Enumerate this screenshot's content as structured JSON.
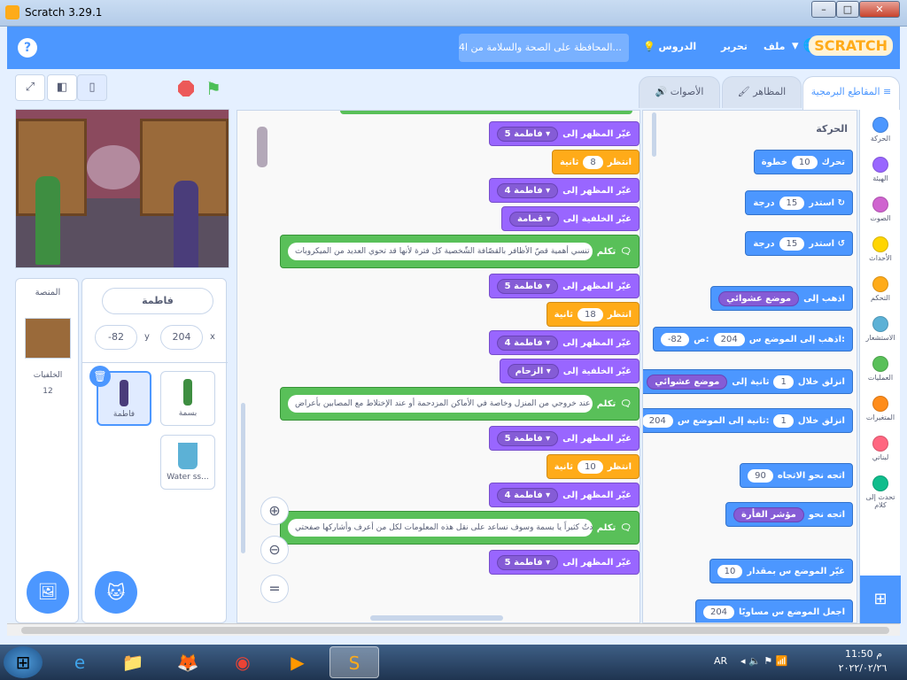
{
  "window": {
    "title": "Scratch 3.29.1",
    "minimize": "–",
    "maximize": "□",
    "close": "✕"
  },
  "menubar": {
    "logo": "SCRATCH",
    "file": "ملف",
    "edit": "تحرير",
    "tutorials": "الدروس",
    "project_title": "4المحافظة على الصحة والسلامة من ا...",
    "help": "?"
  },
  "tabs": {
    "code": "المقاطع البرمجية",
    "costumes": "المظاهر",
    "sounds": "الأصوات"
  },
  "sprite_info": {
    "name": "فاطمة",
    "x_label": "x",
    "x_value": "204",
    "y_label": "y",
    "y_value": "-82",
    "sprites": [
      {
        "name": "فاطمة"
      },
      {
        "name": "بسمة"
      },
      {
        "name": "Water ss..."
      }
    ]
  },
  "stage_panel": {
    "title": "المنصة",
    "backdrops_label": "الخلفيات",
    "backdrops_count": "12"
  },
  "script": [
    {
      "type": "looks",
      "text": "غيّر المظهر إلى",
      "value": "فاطمة 5"
    },
    {
      "type": "ctrl",
      "text": "انتظر",
      "value": "8",
      "suffix": "ثانية"
    },
    {
      "type": "looks",
      "text": "غيّر المظهر إلى",
      "value": "فاطمة 4"
    },
    {
      "type": "looks",
      "text": "غيّر الخلفية إلى",
      "value": "قمامة"
    },
    {
      "type": "say",
      "text": "تكلم",
      "value": "ولا تنسي أهمية قصّ الأظافر بالقصّافة الشّخصية كل فترة لأنها قد تحوي العديد من الميكروبات"
    },
    {
      "type": "looks",
      "text": "غيّر المظهر إلى",
      "value": "فاطمة 5"
    },
    {
      "type": "ctrl",
      "text": "انتظر",
      "value": "18",
      "suffix": "ثانية"
    },
    {
      "type": "looks",
      "text": "غيّر المظهر إلى",
      "value": "فاطمة 4"
    },
    {
      "type": "looks",
      "text": "غيّر الخلفية إلى",
      "value": "الزحام"
    },
    {
      "type": "say",
      "text": "تكلم",
      "value": "نعم أنا أرتدي كمامتي عند خروجي من المنزل وخاصة في الأماكن المزدحمة أو عند الإختلاط مع المصابين بأعراض"
    },
    {
      "type": "looks",
      "text": "غيّر المظهر إلى",
      "value": "فاطمة 5"
    },
    {
      "type": "ctrl",
      "text": "انتظر",
      "value": "10",
      "suffix": "ثانية"
    },
    {
      "type": "looks",
      "text": "غيّر المظهر إلى",
      "value": "فاطمة 4"
    },
    {
      "type": "say",
      "text": "تكلم",
      "value": "وأنا أيضا إستفدتُ كثيراً يا بسمة وسوف نساعد على نقل هذه المعلومات لكل من أعرف وأشاركها صفحتي"
    },
    {
      "type": "looks",
      "text": "غيّر المظهر إلى",
      "value": "فاطمة 5"
    }
  ],
  "palette": {
    "section_title": "الحركة",
    "blocks": [
      {
        "text": "تحرك",
        "value": "10",
        "suffix": "خطوة"
      },
      {
        "text": "استدر ↻",
        "value": "15",
        "suffix": "درجة"
      },
      {
        "text": "استدر ↺",
        "value": "15",
        "suffix": "درجة"
      },
      {
        "text": "اذهب إلى",
        "value": "موضع عشوائي",
        "suffix": ""
      },
      {
        "text": "اذهب إلى الموضع س:",
        "value": "204",
        "suffix": "ص:",
        "value2": "-82"
      },
      {
        "text": "انزلق خلال",
        "value": "1",
        "suffix": "ثانية إلى",
        "value2": "موضع عشوائي"
      },
      {
        "text": "انزلق خلال",
        "value": "1",
        "suffix": "ثانية إلى الموضع س:",
        "value2": "204",
        "suffix2": "ص:",
        "value3": "-82"
      },
      {
        "text": "اتجه نحو الاتجاه",
        "value": "90",
        "suffix": ""
      },
      {
        "text": "اتجه نحو",
        "value": "مؤشر الفأرة",
        "suffix": ""
      },
      {
        "text": "غيّر الموضع س بمقدار",
        "value": "10",
        "suffix": ""
      },
      {
        "text": "اجعل الموضع س مساويًا",
        "value": "204",
        "suffix": ""
      }
    ]
  },
  "categories": [
    {
      "label": "الحركة",
      "color": "#4c97ff"
    },
    {
      "label": "الهيئة",
      "color": "#9966ff"
    },
    {
      "label": "الصوت",
      "color": "#cf63cf"
    },
    {
      "label": "الأحداث",
      "color": "#ffd500"
    },
    {
      "label": "التحكم",
      "color": "#ffab19"
    },
    {
      "label": "الاستشعار",
      "color": "#5cb1d6"
    },
    {
      "label": "العمليات",
      "color": "#59c059"
    },
    {
      "label": "المتغيرات",
      "color": "#ff8c1a"
    },
    {
      "label": "لبناتي",
      "color": "#ff6680"
    },
    {
      "label": "تحدث إلى كلام",
      "color": "#0fbd8c"
    }
  ],
  "taskbar": {
    "lang": "AR",
    "time": "11:50 م",
    "date": "٢٠٢٢/٠٢/٢٦"
  }
}
